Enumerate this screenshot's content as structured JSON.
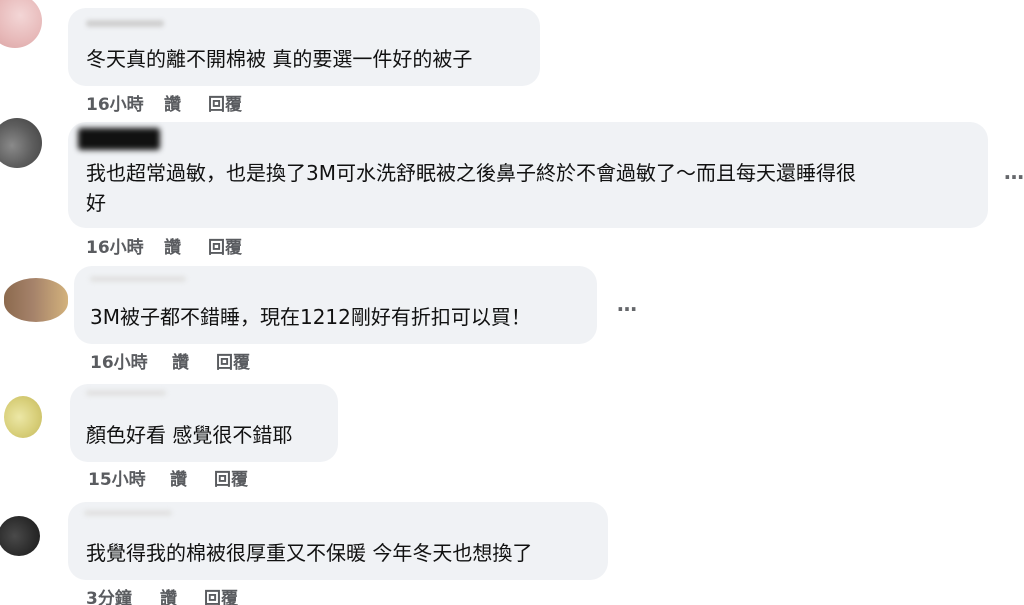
{
  "comments": [
    {
      "text": "冬天真的離不開棉被 真的要選一件好的被子",
      "time": "16小時",
      "like": "讚",
      "reply": "回覆"
    },
    {
      "text": "我也超常過敏，也是換了3M可水洗舒眠被之後鼻子終於不會過敏了～而且每天還睡得很\n好",
      "time": "16小時",
      "like": "讚",
      "reply": "回覆",
      "more": "…"
    },
    {
      "text": "3M被子都不錯睡，現在1212剛好有折扣可以買！",
      "time": "16小時",
      "like": "讚",
      "reply": "回覆",
      "more": "…"
    },
    {
      "text": "顏色好看 感覺很不錯耶",
      "time": "15小時",
      "like": "讚",
      "reply": "回覆"
    },
    {
      "text": "我覺得我的棉被很厚重又不保暖 今年冬天也想換了",
      "time": "3分鐘",
      "like": "讚",
      "reply": "回覆"
    }
  ]
}
